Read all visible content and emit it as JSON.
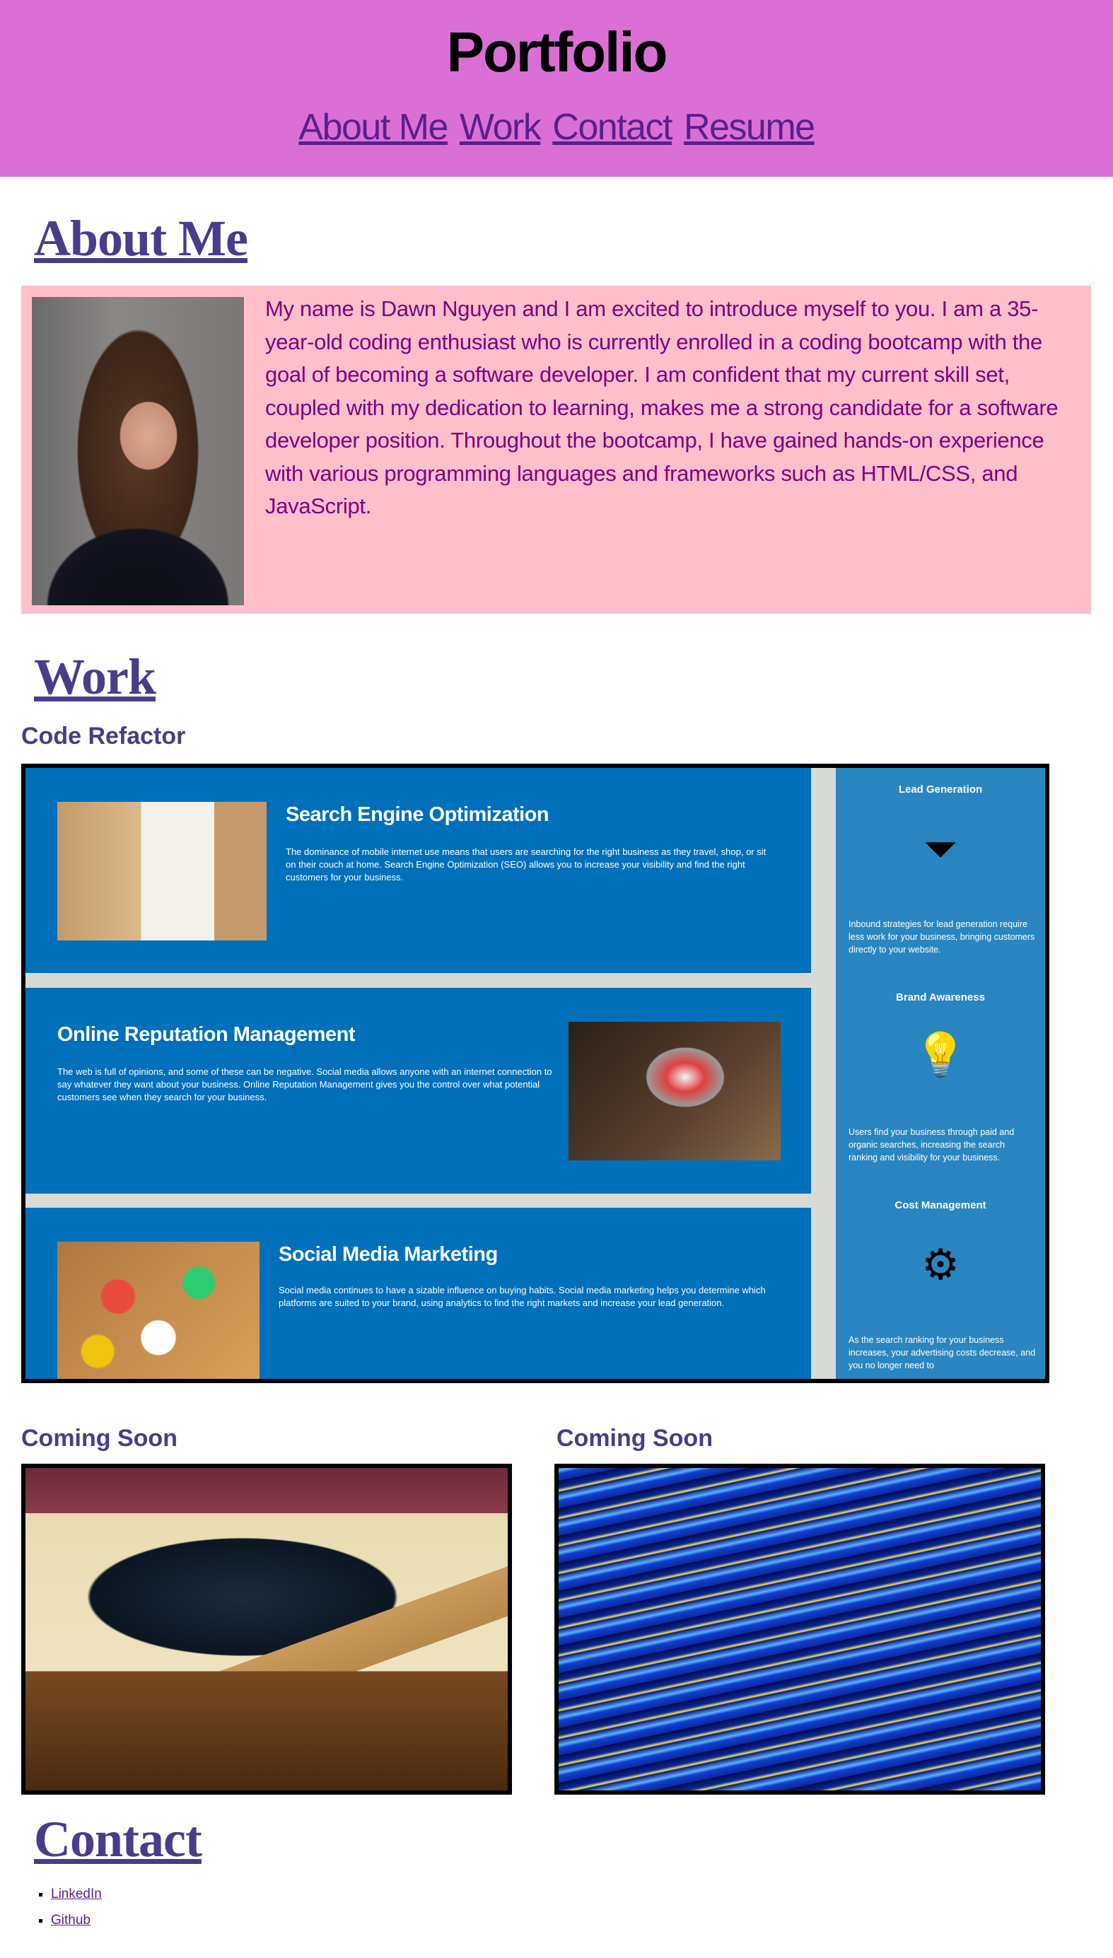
{
  "header": {
    "title": "Portfolio",
    "nav": [
      "About Me",
      "Work",
      "Contact",
      "Resume"
    ]
  },
  "about": {
    "heading": "About Me",
    "bio": "My name is Dawn Nguyen and I am excited to introduce myself to you. I am a 35-year-old coding enthusiast who is currently enrolled in a coding bootcamp with the goal of becoming a software developer. I am confident that my current skill set, coupled with my dedication to learning, makes me a strong candidate for a software developer position. Throughout the bootcamp, I have gained hands-on experience with various programming languages and frameworks such as HTML/CSS, and JavaScript."
  },
  "work": {
    "heading": "Work",
    "projects": [
      {
        "title": "Code Refactor",
        "screenshot": {
          "panels": [
            {
              "title": "Search Engine Optimization",
              "text": "The dominance of mobile internet use means that users are searching for the right business as they travel, shop, or sit on their couch at home. Search Engine Optimization (SEO) allows you to increase your visibility and find the right customers for your business."
            },
            {
              "title": "Online Reputation Management",
              "text": "The web is full of opinions, and some of these can be negative. Social media allows anyone with an internet connection to say whatever they want about your business. Online Reputation Management gives you the control over what potential customers see when they search for your business."
            },
            {
              "title": "Social Media Marketing",
              "text": "Social media continues to have a sizable influence on buying habits. Social media marketing helps you determine which platforms are suited to your brand, using analytics to find the right markets and increase your lead generation."
            }
          ],
          "sidebar": [
            {
              "title": "Lead Generation",
              "icon": "funnel-icon",
              "text": "Inbound strategies for lead generation require less work for your business, bringing customers directly to your website."
            },
            {
              "title": "Brand Awareness",
              "icon": "lightbulb-person-icon",
              "text": "Users find your business through paid and organic searches, increasing the search ranking and visibility for your business."
            },
            {
              "title": "Cost Management",
              "icon": "gear-dollar-icon",
              "text": "As the search ranking for your business increases, your advertising costs decrease, and you no longer need to"
            }
          ]
        }
      },
      {
        "title": "Coming Soon"
      },
      {
        "title": "Coming Soon"
      }
    ]
  },
  "contact": {
    "heading": "Contact",
    "links": [
      "LinkedIn",
      "Github"
    ]
  },
  "colors": {
    "header_bg": "#da70d6",
    "heading": "#483d8b",
    "about_bg": "#ffc0cb",
    "about_text": "#800080",
    "link": "#5b1f8c"
  }
}
